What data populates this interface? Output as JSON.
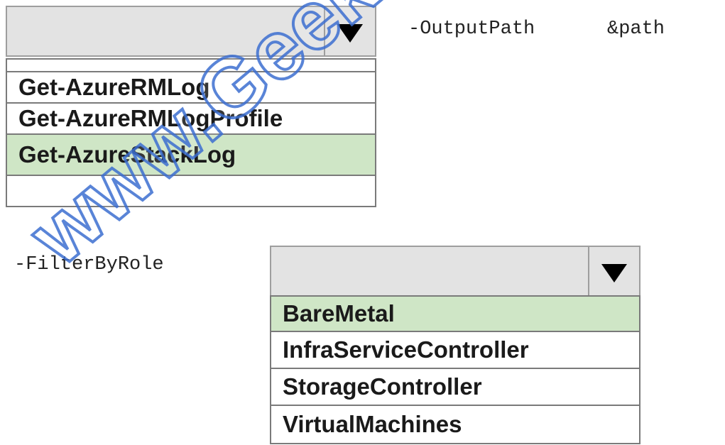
{
  "dropdown1": {
    "selected_value": "",
    "items": [
      {
        "label": "Get-AzureRMLog",
        "selected": false
      },
      {
        "label": "Get-AzureRMLogProfile",
        "selected": false
      },
      {
        "label": "Get-AzureStackLog",
        "selected": true
      },
      {
        "label": "",
        "selected": false
      }
    ]
  },
  "dropdown2": {
    "selected_value": "",
    "items": [
      {
        "label": "BareMetal",
        "selected": true
      },
      {
        "label": "InfraServiceController",
        "selected": false
      },
      {
        "label": "StorageController",
        "selected": false
      },
      {
        "label": "VirtualMachines",
        "selected": false
      }
    ]
  },
  "code": {
    "output_path_param": "-OutputPath",
    "path_var": "&path",
    "filter_param": "-FilterByRole"
  },
  "watermark": {
    "text": "www.GeekCert.com"
  },
  "colors": {
    "selected_bg": "#cfe6c6",
    "header_bg": "#e3e3e3",
    "watermark_stroke": "#3d6fd1"
  },
  "icons": {
    "dropdown_arrow": "triangle-down-icon"
  }
}
